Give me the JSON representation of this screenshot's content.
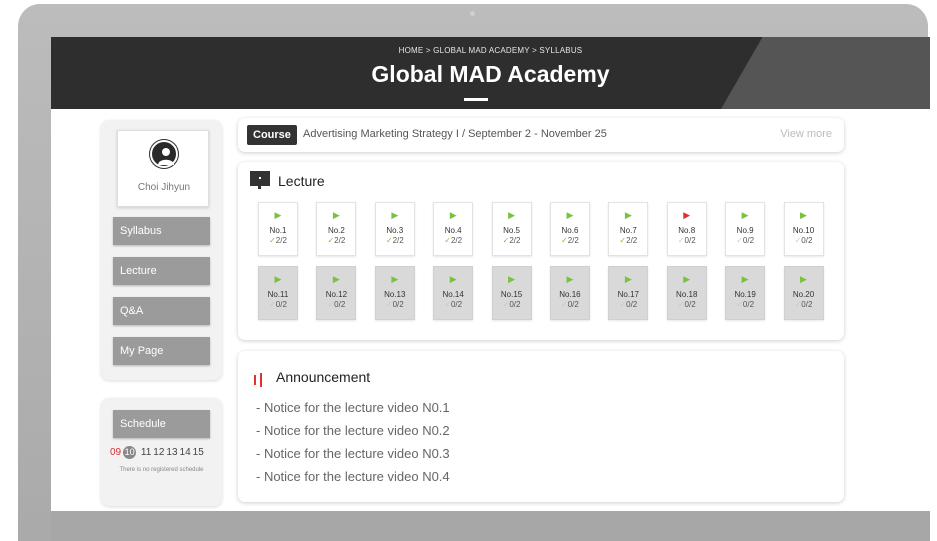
{
  "header": {
    "breadcrumb": "HOME > GLOBAL MAD ACADEMY > SYLLABUS",
    "title": "Global MAD Academy"
  },
  "profile": {
    "name": "Choi Jihyun"
  },
  "sidebar": {
    "items": [
      {
        "label": "Syllabus"
      },
      {
        "label": "Lecture"
      },
      {
        "label": "Q&A"
      },
      {
        "label": "My Page"
      }
    ]
  },
  "schedule": {
    "label": "Schedule",
    "days": [
      "09",
      "10",
      "11",
      "12",
      "13",
      "14",
      "15"
    ],
    "today": "09",
    "selected": "10",
    "empty_text": "There is no registered schedule"
  },
  "course": {
    "tag": "Course",
    "text": "Advertising Marketing Strategy I / September 2 - November 25",
    "view_more": "View more"
  },
  "lecture": {
    "title": "Lecture",
    "colors": {
      "play": "#7ac142",
      "play_current": "#e03030",
      "locked_bg": "#d9d9d9"
    },
    "items": [
      {
        "no": "No.1",
        "progress": "2/2",
        "done": true,
        "locked": false,
        "current": false
      },
      {
        "no": "No.2",
        "progress": "2/2",
        "done": true,
        "locked": false,
        "current": false
      },
      {
        "no": "No.3",
        "progress": "2/2",
        "done": true,
        "locked": false,
        "current": false
      },
      {
        "no": "No.4",
        "progress": "2/2",
        "done": true,
        "locked": false,
        "current": false
      },
      {
        "no": "No.5",
        "progress": "2/2",
        "done": true,
        "locked": false,
        "current": false
      },
      {
        "no": "No.6",
        "progress": "2/2",
        "done": true,
        "locked": false,
        "current": false
      },
      {
        "no": "No.7",
        "progress": "2/2",
        "done": true,
        "locked": false,
        "current": false
      },
      {
        "no": "No.8",
        "progress": "0/2",
        "done": false,
        "locked": false,
        "current": true
      },
      {
        "no": "No.9",
        "progress": "0/2",
        "done": false,
        "locked": false,
        "current": false
      },
      {
        "no": "No.10",
        "progress": "0/2",
        "done": false,
        "locked": false,
        "current": false
      },
      {
        "no": "No.11",
        "progress": "0/2",
        "done": false,
        "locked": true,
        "current": false
      },
      {
        "no": "No.12",
        "progress": "0/2",
        "done": false,
        "locked": true,
        "current": false
      },
      {
        "no": "No.13",
        "progress": "0/2",
        "done": false,
        "locked": true,
        "current": false
      },
      {
        "no": "No.14",
        "progress": "0/2",
        "done": false,
        "locked": true,
        "current": false
      },
      {
        "no": "No.15",
        "progress": "0/2",
        "done": false,
        "locked": true,
        "current": false
      },
      {
        "no": "No.16",
        "progress": "0/2",
        "done": false,
        "locked": true,
        "current": false
      },
      {
        "no": "No.17",
        "progress": "0/2",
        "done": false,
        "locked": true,
        "current": false
      },
      {
        "no": "No.18",
        "progress": "0/2",
        "done": false,
        "locked": true,
        "current": false
      },
      {
        "no": "No.19",
        "progress": "0/2",
        "done": false,
        "locked": true,
        "current": false
      },
      {
        "no": "No.20",
        "progress": "0/2",
        "done": false,
        "locked": true,
        "current": false
      }
    ]
  },
  "announcement": {
    "title": "Announcement",
    "items": [
      "- Notice for the lecture video N0.1",
      "- Notice for the lecture video N0.2",
      "- Notice for the lecture video N0.3",
      "- Notice for the lecture video N0.4"
    ]
  }
}
